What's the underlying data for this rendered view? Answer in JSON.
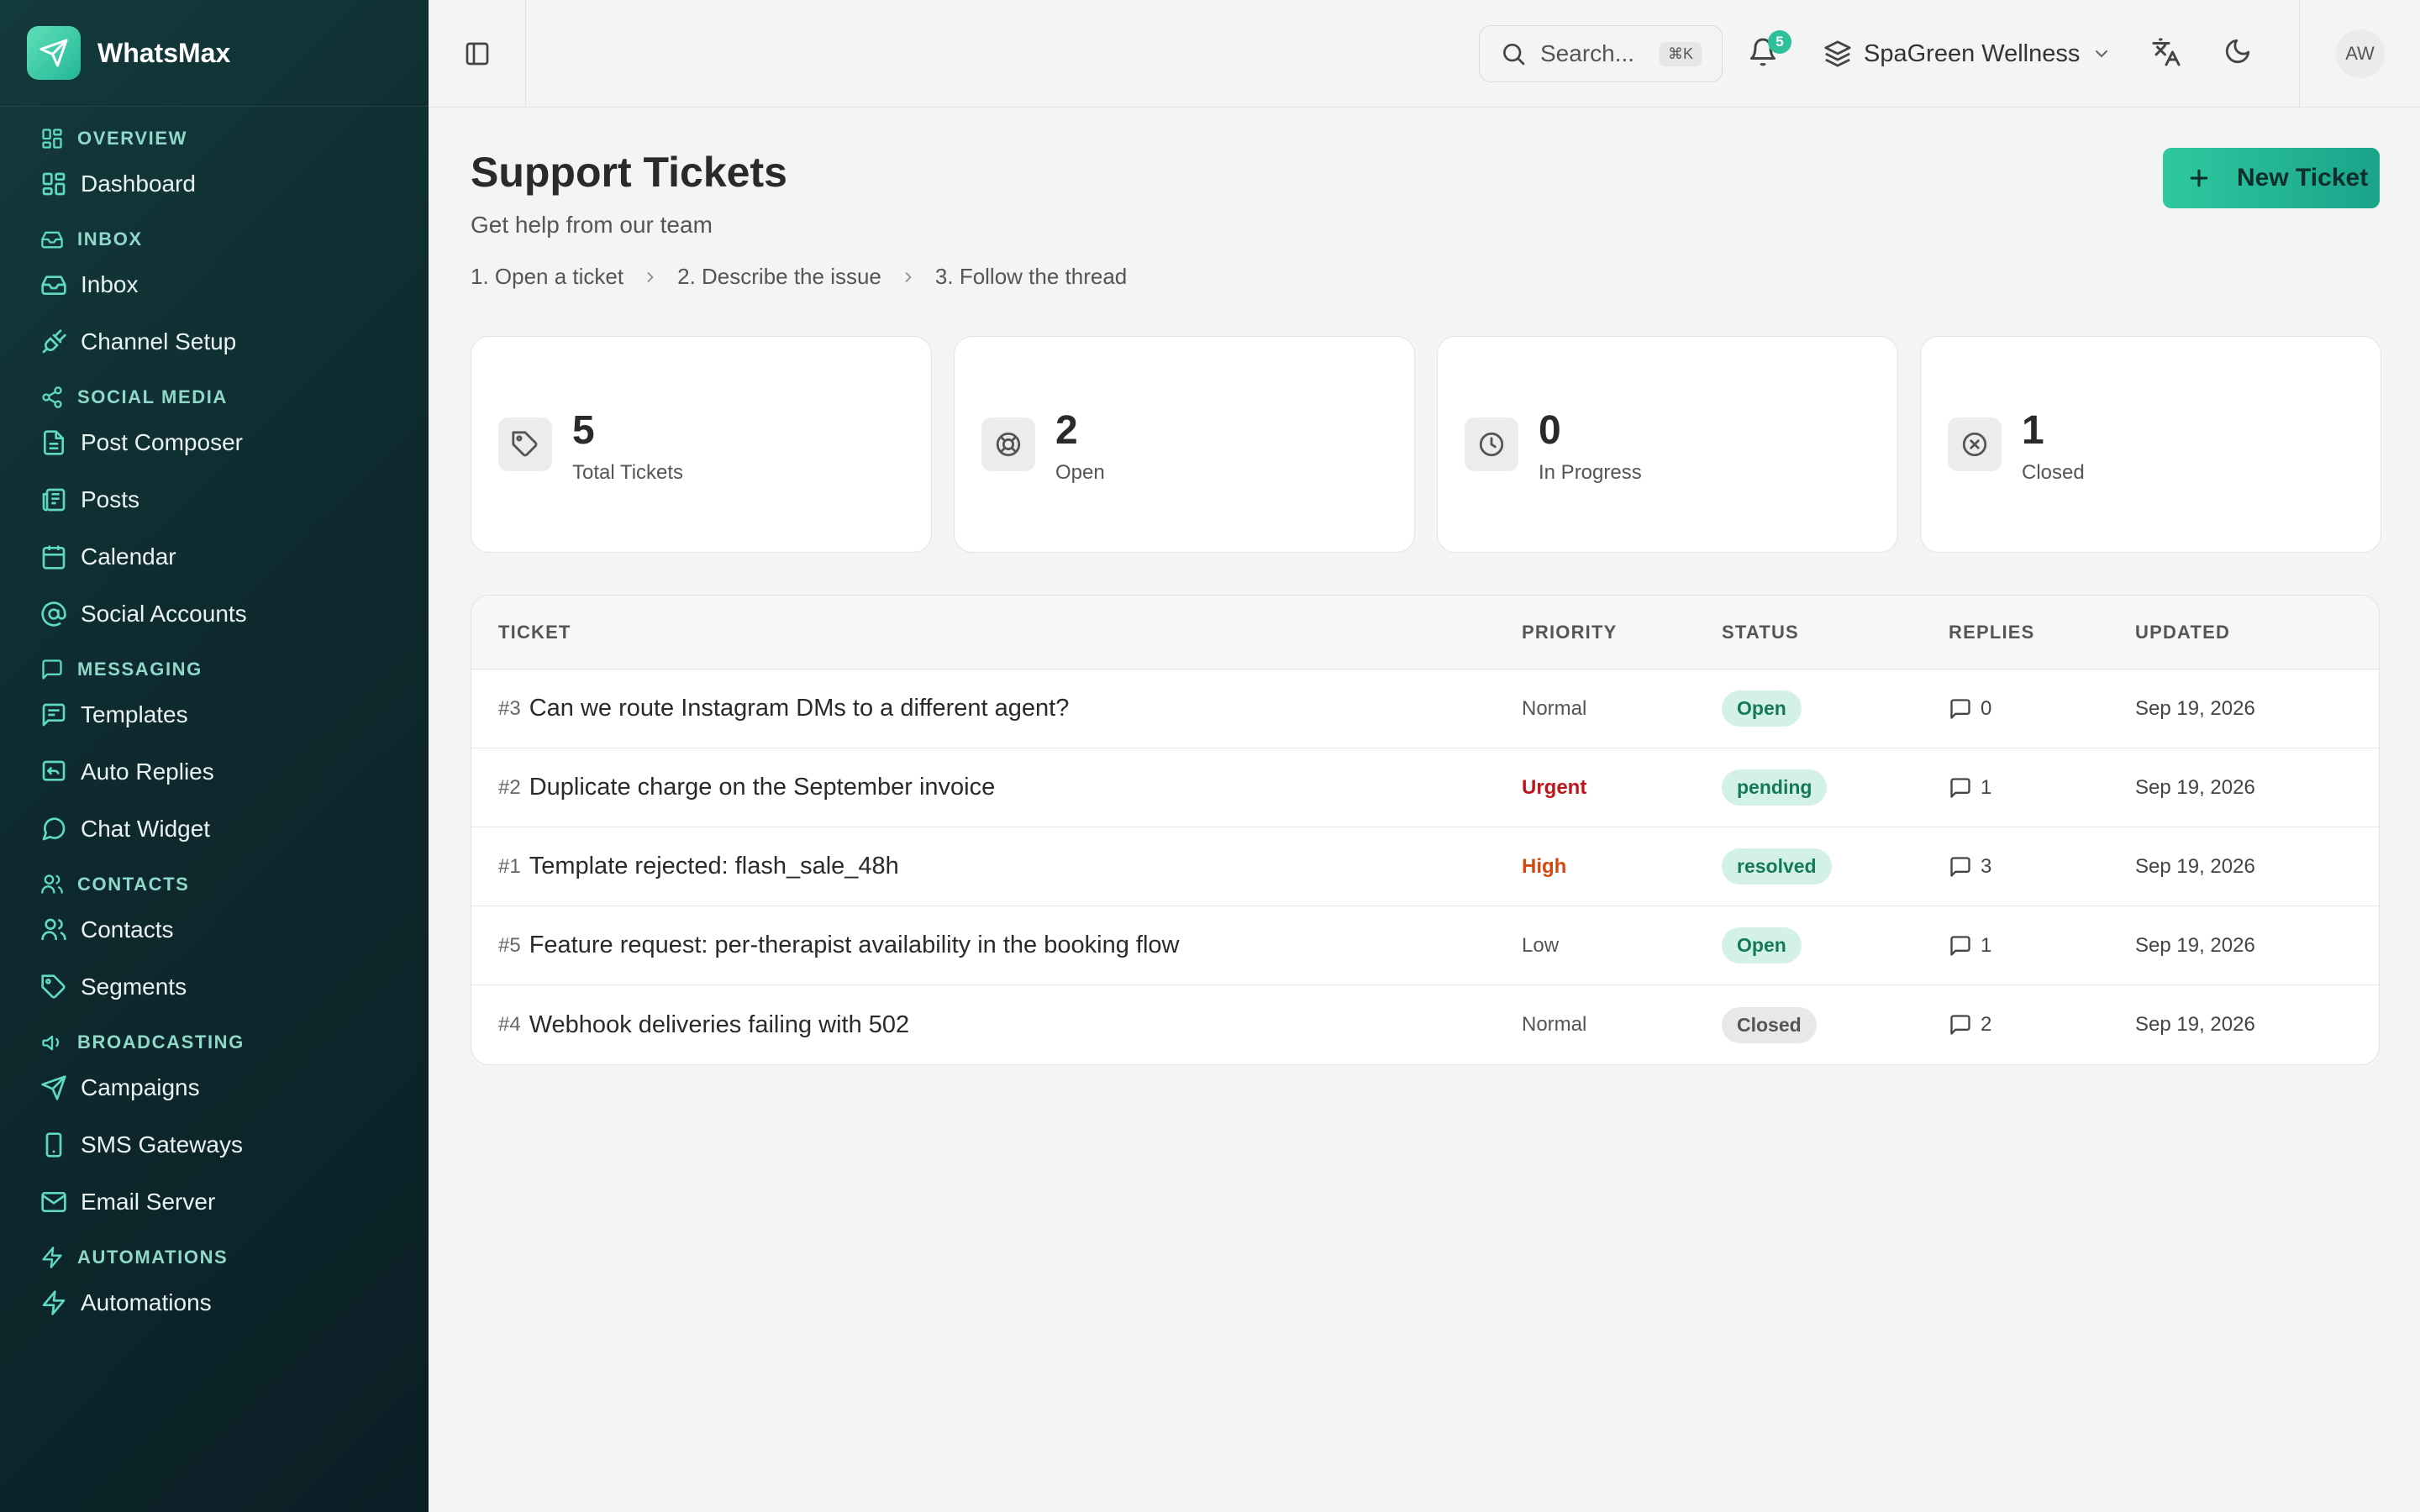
{
  "app": {
    "name": "WhatsMax"
  },
  "sidebar": {
    "groups": [
      {
        "section": "OVERVIEW",
        "items": [
          {
            "label": "Dashboard"
          }
        ]
      },
      {
        "section": "INBOX",
        "items": [
          {
            "label": "Inbox"
          },
          {
            "label": "Channel Setup"
          }
        ]
      },
      {
        "section": "SOCIAL MEDIA",
        "items": [
          {
            "label": "Post Composer"
          },
          {
            "label": "Posts"
          },
          {
            "label": "Calendar"
          },
          {
            "label": "Social Accounts"
          }
        ]
      },
      {
        "section": "MESSAGING",
        "items": [
          {
            "label": "Templates"
          },
          {
            "label": "Auto Replies"
          },
          {
            "label": "Chat Widget"
          }
        ]
      },
      {
        "section": "CONTACTS",
        "items": [
          {
            "label": "Contacts"
          },
          {
            "label": "Segments"
          }
        ]
      },
      {
        "section": "BROADCASTING",
        "items": [
          {
            "label": "Campaigns"
          },
          {
            "label": "SMS Gateways"
          },
          {
            "label": "Email Server"
          }
        ]
      },
      {
        "section": "AUTOMATIONS",
        "items": [
          {
            "label": "Automations"
          }
        ]
      }
    ]
  },
  "topbar": {
    "search_placeholder": "Search...",
    "search_shortcut": "⌘K",
    "notification_count": "5",
    "workspace": "SpaGreen Wellness",
    "avatar_initials": "AW"
  },
  "page": {
    "title": "Support Tickets",
    "subtitle": "Get help from our team",
    "steps": [
      "1. Open a ticket",
      "2. Describe the issue",
      "3. Follow the thread"
    ],
    "new_button": "New Ticket"
  },
  "stats": [
    {
      "value": "5",
      "label": "Total Tickets",
      "icon": "tag-icon"
    },
    {
      "value": "2",
      "label": "Open",
      "icon": "lifebuoy-icon"
    },
    {
      "value": "0",
      "label": "In Progress",
      "icon": "clock-icon"
    },
    {
      "value": "1",
      "label": "Closed",
      "icon": "x-circle-icon"
    }
  ],
  "table": {
    "headers": [
      "TICKET",
      "PRIORITY",
      "STATUS",
      "REPLIES",
      "UPDATED"
    ],
    "rows": [
      {
        "num": "#3",
        "title": "Can we route Instagram DMs to a different agent?",
        "priority": "Normal",
        "status": "Open",
        "replies": "0",
        "updated": "Sep 19, 2026"
      },
      {
        "num": "#2",
        "title": "Duplicate charge on the September invoice",
        "priority": "Urgent",
        "status": "pending",
        "replies": "1",
        "updated": "Sep 19, 2026"
      },
      {
        "num": "#1",
        "title": "Template rejected: flash_sale_48h",
        "priority": "High",
        "status": "resolved",
        "replies": "3",
        "updated": "Sep 19, 2026"
      },
      {
        "num": "#5",
        "title": "Feature request: per-therapist availability in the booking flow",
        "priority": "Low",
        "status": "Open",
        "replies": "1",
        "updated": "Sep 19, 2026"
      },
      {
        "num": "#4",
        "title": "Webhook deliveries failing with 502",
        "priority": "Normal",
        "status": "Closed",
        "replies": "2",
        "updated": "Sep 19, 2026"
      }
    ]
  },
  "colors": {
    "accent": "#2fbf9a",
    "sidebar_bg": "#0e2a2e",
    "urgent": "#c0141b",
    "high": "#d4480f"
  }
}
